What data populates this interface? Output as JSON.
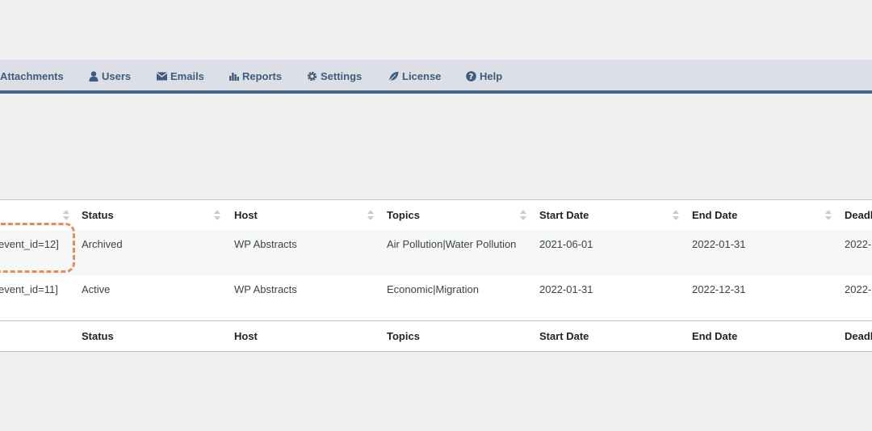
{
  "nav": {
    "items": [
      {
        "label": "Attachments",
        "icon": "paperclip-icon"
      },
      {
        "label": "Users",
        "icon": "user-icon"
      },
      {
        "label": "Emails",
        "icon": "envelope-icon"
      },
      {
        "label": "Reports",
        "icon": "bar-chart-icon"
      },
      {
        "label": "Settings",
        "icon": "gear-icon"
      },
      {
        "label": "License",
        "icon": "leaf-icon"
      },
      {
        "label": "Help",
        "icon": "question-circle-icon"
      }
    ],
    "accent_color": "#4a6388",
    "text_color": "#3e5b80"
  },
  "table": {
    "columns": [
      "Status",
      "Host",
      "Topics",
      "Start Date",
      "End Date",
      "Deadl"
    ],
    "rows": [
      {
        "shortcode": "event_id=12]",
        "status": "Archived",
        "host": "WP Abstracts",
        "topics": "Air Pollution|Water Pollution",
        "start": "2021-06-01",
        "end": "2022-01-31",
        "deadline": "2022-"
      },
      {
        "shortcode": "event_id=11]",
        "status": "Active",
        "host": "WP Abstracts",
        "topics": "Economic|Migration",
        "start": "2022-01-31",
        "end": "2022-12-31",
        "deadline": "2022-"
      }
    ],
    "highlight_color": "#ea8a55"
  }
}
